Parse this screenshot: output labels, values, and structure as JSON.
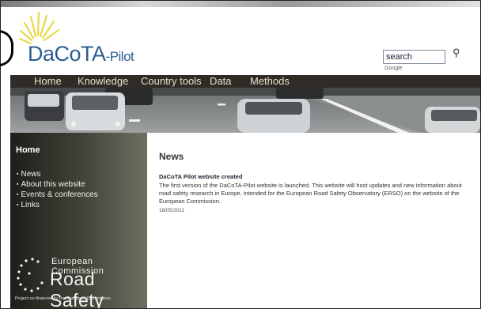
{
  "header": {
    "logo_main": "DaCoTA",
    "logo_suffix": "-Pilot",
    "search": {
      "value": "search",
      "engine_label": "Google"
    }
  },
  "nav": {
    "items": [
      "Home",
      "Knowledge",
      "Country tools",
      "Data",
      "Methods"
    ]
  },
  "sidebar": {
    "title": "Home",
    "items": [
      "News",
      "About this website",
      "Events & conferences",
      "Links"
    ],
    "ec_logo": {
      "title": "European Commission",
      "subtitle": "Road Safety",
      "cofinanced": "Project co-financed by the European Commission"
    }
  },
  "main": {
    "title": "News",
    "news": [
      {
        "title": "DaCoTA Pilot website created",
        "body": "The first version of the DaCoTA-Pilot website is launched. This website will host updates and new information about road safety research in Europe, intended for the European Road Safety Observatory (ERSO) on the website of the European Commission.",
        "date": "18/05/2011"
      }
    ]
  },
  "colors": {
    "nav_bg": "#2f2c28",
    "nav_text": "#e8e0c8",
    "logo_blue": "#2e5e93",
    "sun_yellow": "#e8d84a"
  }
}
